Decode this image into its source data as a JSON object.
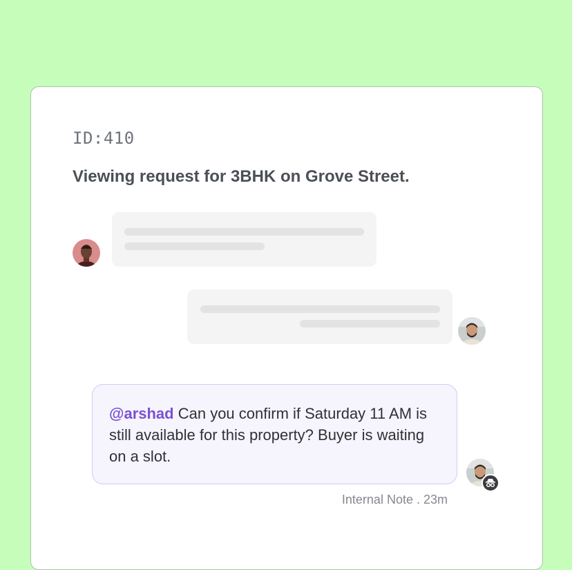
{
  "ticket": {
    "id_label": "ID:410",
    "title": "Viewing request for 3BHK on Grove Street."
  },
  "conversation": {
    "incoming_avatar_icon": "person-avatar",
    "outgoing_avatar_icon": "person-avatar",
    "note": {
      "mention": "@arshad",
      "text": " Can you confirm if Saturday 11 AM is still available for this property? Buyer is waiting on a slot.",
      "meta": "Internal Note . 23m",
      "badge_icon": "incognito-icon",
      "background": "#f6f4fc",
      "border": "#d4ccef",
      "mention_color": "#7b4fd6"
    }
  },
  "colors": {
    "page_bg": "#c6fdbb",
    "card_bg": "#ffffff",
    "skeleton_bubble": "#f4f4f4",
    "skeleton_line": "#e3e3e3"
  }
}
